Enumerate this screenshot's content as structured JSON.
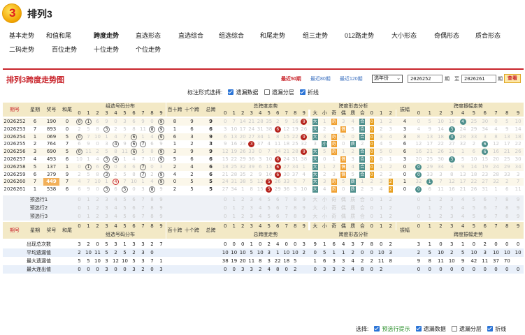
{
  "app": {
    "title": "排列3",
    "logo_text": "3"
  },
  "nav": [
    {
      "label": "基本走势",
      "row": 0,
      "active": false
    },
    {
      "label": "和值和尾",
      "row": 0,
      "active": false
    },
    {
      "label": "跨度走势",
      "row": 0,
      "active": true
    },
    {
      "label": "直选形态",
      "row": 0,
      "active": false
    },
    {
      "label": "直选综合",
      "row": 0,
      "active": false
    },
    {
      "label": "组选综合",
      "row": 0,
      "active": false
    },
    {
      "label": "和尾走势",
      "row": 0,
      "active": false
    },
    {
      "label": "组三走势",
      "row": 0,
      "active": false
    },
    {
      "label": "012路走势",
      "row": 0,
      "active": false
    },
    {
      "label": "大小形态",
      "row": 0,
      "active": false
    },
    {
      "label": "奇偶形态",
      "row": 0,
      "active": false
    },
    {
      "label": "质合形态",
      "row": 0,
      "active": false
    },
    {
      "label": "二码走势",
      "row": 1,
      "active": false
    },
    {
      "label": "百位走势",
      "row": 1,
      "active": false
    },
    {
      "label": "十位走势",
      "row": 1,
      "active": false
    },
    {
      "label": "个位走势",
      "row": 1,
      "active": false
    }
  ],
  "panel": {
    "title": "排列3跨度走势图",
    "recent": [
      "最近50期",
      "最近80期",
      "最近120期"
    ],
    "period_select": "选年份",
    "from_issue": "2026252",
    "to_issue": "2026261",
    "period_unit": "期",
    "to_label": "至",
    "query": "查看",
    "mark_label": "标注形式选择:",
    "mark_opts": [
      {
        "label": "遗漏数据",
        "checked": true
      },
      {
        "label": "遗漏分层",
        "checked": false
      },
      {
        "label": "折线",
        "checked": true
      }
    ]
  },
  "headers": {
    "issue": "期号",
    "week": "星期",
    "prize": "奖号",
    "sum": "和尾",
    "group_dist": "组选号码分布",
    "bai_shi": "百十跨",
    "shi_ge": "十个跨",
    "span": "总跨",
    "span_trend": "总跨度走势",
    "form": "跨度形态分析",
    "span_tail": "振幅",
    "span_amp": "跨度振幅走势",
    "form_labels": [
      "大",
      "小",
      "奇",
      "偶",
      "质",
      "合",
      "0",
      "1",
      "2"
    ],
    "digits": [
      "0",
      "1",
      "2",
      "3",
      "4",
      "5",
      "6",
      "7",
      "8",
      "9"
    ]
  },
  "rows": [
    {
      "issue": "2026252",
      "week": "6",
      "prize": "190",
      "sum": "0",
      "bs": "8",
      "sg": "9",
      "span": "9",
      "amp": "4"
    },
    {
      "issue": "2026253",
      "week": "7",
      "prize": "893",
      "sum": "0",
      "bs": "1",
      "sg": "6",
      "span": "6",
      "amp": "3"
    },
    {
      "issue": "2026254",
      "week": "1",
      "prize": "069",
      "sum": "5",
      "sg": "3",
      "bs": "6",
      "span": "9",
      "amp": "3"
    },
    {
      "issue": "2026255",
      "week": "2",
      "prize": "764",
      "sum": "7",
      "bs": "1",
      "sg": "2",
      "span": "3",
      "amp": "6"
    },
    {
      "issue": "2026256",
      "week": "3",
      "prize": "690",
      "sum": "5",
      "bs": "3",
      "sg": "9",
      "span": "9",
      "amp": "6"
    },
    {
      "issue": "2026257",
      "week": "4",
      "prize": "493",
      "sum": "6",
      "bs": "5",
      "sg": "6",
      "span": "6",
      "amp": "3"
    },
    {
      "issue": "2026258",
      "week": "5",
      "prize": "137",
      "sum": "1",
      "bs": "2",
      "sg": "4",
      "span": "6",
      "amp": "0"
    },
    {
      "issue": "2026259",
      "week": "6",
      "prize": "379",
      "sum": "9",
      "bs": "4",
      "sg": "2",
      "span": "6",
      "amp": "0"
    },
    {
      "issue": "2026260",
      "week": "7",
      "prize": "449",
      "sum": "7",
      "bs": "0",
      "sg": "5",
      "span": "5",
      "amp": "1"
    },
    {
      "issue": "2026261",
      "week": "1",
      "prize": "538",
      "sum": "6",
      "bs": "2",
      "sg": "5",
      "span": "5",
      "amp": "0"
    }
  ],
  "forecast": [
    "预选行1",
    "预选行2",
    "预选行3"
  ],
  "stats": [
    {
      "label": "出现总次数",
      "group": [
        "3",
        "2",
        "0",
        "5",
        "3",
        "1",
        "3",
        "3",
        "2",
        "7"
      ],
      "span": [
        "0",
        "0",
        "0",
        "1",
        "0",
        "2",
        "4",
        "0",
        "0",
        "3"
      ],
      "form": [
        "9",
        "1",
        "6",
        "4",
        "3",
        "7",
        "8",
        "0",
        "2"
      ],
      "amp": [
        "3",
        "1",
        "0",
        "3",
        "1",
        "0",
        "2",
        "0",
        "0",
        "0"
      ]
    },
    {
      "label": "平均遗漏值",
      "group": [
        "2",
        "10",
        "11",
        "5",
        "2",
        "5",
        "2",
        "3",
        "0"
      ],
      "span": [
        "10",
        "10",
        "10",
        "5",
        "10",
        "3",
        "1",
        "10",
        "10",
        "2"
      ],
      "form": [
        "0",
        "5",
        "1",
        "1",
        "2",
        "0",
        "0",
        "10",
        "3"
      ],
      "amp": [
        "2",
        "5",
        "10",
        "2",
        "5",
        "10",
        "3",
        "10",
        "10",
        "10"
      ]
    },
    {
      "label": "最大遗漏值",
      "group": [
        "5",
        "5",
        "10",
        "3",
        "12",
        "10",
        "5",
        "3",
        "7",
        "1"
      ],
      "span": [
        "38",
        "19",
        "20",
        "11",
        "8",
        "3",
        "22",
        "18",
        "5"
      ],
      "form": [
        "1",
        "6",
        "3",
        "3",
        "4",
        "2",
        "2",
        "11",
        "8"
      ],
      "amp": [
        "9",
        "8",
        "11",
        "10",
        "9",
        "42",
        "11",
        "37",
        "70"
      ]
    },
    {
      "label": "最大连出值",
      "group": [
        "0",
        "0",
        "0",
        "3",
        "0",
        "0",
        "3",
        "2",
        "0",
        "3"
      ],
      "span": [
        "0",
        "0",
        "3",
        "3",
        "2",
        "4",
        "8",
        "0",
        "2"
      ],
      "form": [
        "0",
        "3",
        "3",
        "2",
        "4",
        "8",
        "0",
        "2"
      ],
      "amp": [
        "0",
        "0",
        "0",
        "0",
        "0",
        "0",
        "0",
        "0",
        "0",
        "0"
      ]
    }
  ],
  "footer": {
    "label": "选择:",
    "opts": [
      {
        "label": "预选行提示",
        "checked": true
      },
      {
        "label": "遗漏数据",
        "checked": true
      },
      {
        "label": "遗漏分层",
        "checked": false
      },
      {
        "label": "折线",
        "checked": true
      }
    ]
  }
}
